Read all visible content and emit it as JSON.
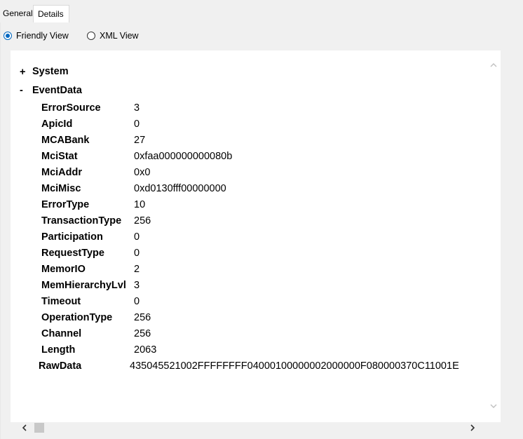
{
  "tabs": [
    {
      "label": "General"
    },
    {
      "label": "Details"
    }
  ],
  "view_options": {
    "friendly_label": "Friendly View",
    "xml_label": "XML View",
    "selected": "Friendly View"
  },
  "tree": {
    "system": {
      "toggle": "+",
      "label": "System"
    },
    "event_data": {
      "toggle": "-",
      "label": "EventData"
    },
    "fields": [
      {
        "name": "ErrorSource",
        "value": "3"
      },
      {
        "name": "ApicId",
        "value": "0"
      },
      {
        "name": "MCABank",
        "value": "27"
      },
      {
        "name": "MciStat",
        "value": "0xfaa000000000080b"
      },
      {
        "name": "MciAddr",
        "value": "0x0"
      },
      {
        "name": "MciMisc",
        "value": "0xd0130fff00000000"
      },
      {
        "name": "ErrorType",
        "value": "10"
      },
      {
        "name": "TransactionType",
        "value": "256"
      },
      {
        "name": "Participation",
        "value": "0"
      },
      {
        "name": "RequestType",
        "value": "0"
      },
      {
        "name": "MemorIO",
        "value": "2"
      },
      {
        "name": "MemHierarchyLvl",
        "value": "3"
      },
      {
        "name": "Timeout",
        "value": "0"
      },
      {
        "name": "OperationType",
        "value": "256"
      },
      {
        "name": "Channel",
        "value": "256"
      },
      {
        "name": "Length",
        "value": "2063"
      }
    ],
    "raw_data": {
      "name": "RawData",
      "value": "435045521002FFFFFFFF04000100000002000000F080000370C11001E"
    }
  },
  "icons": {
    "scroll_up": "chevron-up-icon",
    "scroll_down": "chevron-down-icon",
    "scroll_left": "chevron-left-icon",
    "scroll_right": "chevron-right-icon"
  },
  "colors": {
    "accent": "#0067c0",
    "panel_bg": "#f0f0f0",
    "content_bg": "#ffffff"
  }
}
